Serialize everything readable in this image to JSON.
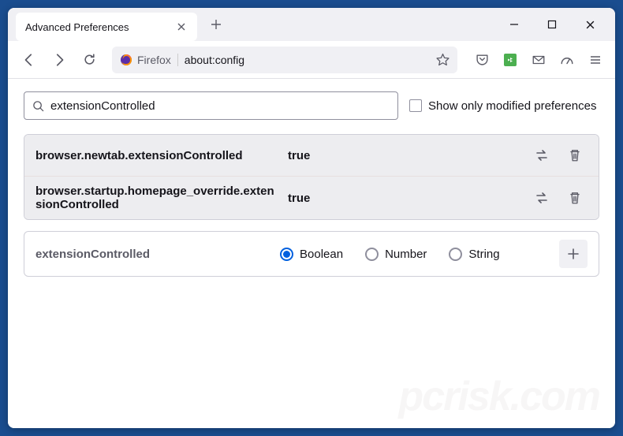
{
  "tab": {
    "title": "Advanced Preferences"
  },
  "urlbar": {
    "identity_label": "Firefox",
    "url": "about:config"
  },
  "search": {
    "value": "extensionControlled",
    "checkbox_label": "Show only modified preferences"
  },
  "prefs": [
    {
      "name": "browser.newtab.extensionControlled",
      "value": "true"
    },
    {
      "name": "browser.startup.homepage_override.extensionControlled",
      "value": "true"
    }
  ],
  "new_pref": {
    "name": "extensionControlled",
    "types": {
      "boolean": "Boolean",
      "number": "Number",
      "string": "String"
    }
  },
  "watermark": "pcrisk.com"
}
